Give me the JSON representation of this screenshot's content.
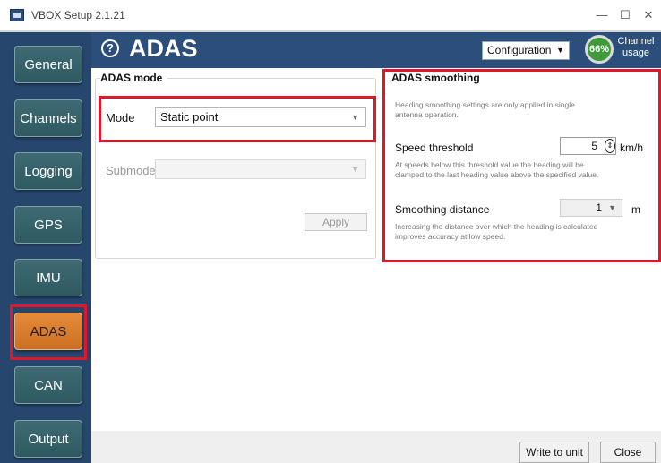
{
  "window": {
    "title": "VBOX Setup 2.1.21",
    "min_glyph": "—",
    "max_glyph": "☐",
    "close_glyph": "✕"
  },
  "sidebar": {
    "items": [
      {
        "label": "General",
        "active": false
      },
      {
        "label": "Channels",
        "active": false
      },
      {
        "label": "Logging",
        "active": false
      },
      {
        "label": "GPS",
        "active": false
      },
      {
        "label": "IMU",
        "active": false
      },
      {
        "label": "ADAS",
        "active": true
      },
      {
        "label": "CAN",
        "active": false
      },
      {
        "label": "Output",
        "active": false
      }
    ]
  },
  "header": {
    "help_glyph": "?",
    "title": "ADAS",
    "configuration_label": "Configuration",
    "channel_usage_percent": "66%",
    "channel_usage_line1": "Channel",
    "channel_usage_line2": "usage"
  },
  "adas_mode": {
    "group_title": "ADAS mode",
    "mode_label": "Mode",
    "mode_value": "Static point",
    "submode_label": "Submode",
    "submode_value": "",
    "apply_label": "Apply"
  },
  "adas_smoothing": {
    "group_title": "ADAS smoothing",
    "intro_hint_1": "Heading smoothing settings are only applied in single",
    "intro_hint_2": "antenna operation.",
    "speed_threshold_label": "Speed threshold",
    "speed_threshold_value": "5",
    "speed_threshold_unit": "km/h",
    "speed_hint_1": "At speeds below this threshold value the heading will be",
    "speed_hint_2": "clamped to the last heading value above the specified value.",
    "smoothing_distance_label": "Smoothing distance",
    "smoothing_distance_value": "1",
    "smoothing_distance_unit": "m",
    "distance_hint_1": "Increasing the distance over which the heading is calculated",
    "distance_hint_2": "improves accuracy at low speed."
  },
  "footer": {
    "write_label": "Write to unit",
    "close_label": "Close"
  },
  "colors": {
    "header_blue": "#2b4f7a",
    "nav_teal": "#3f6a73",
    "nav_active_orange": "#e58a3a",
    "highlight_red": "#e0162b",
    "usage_green": "#3f9a3a"
  }
}
